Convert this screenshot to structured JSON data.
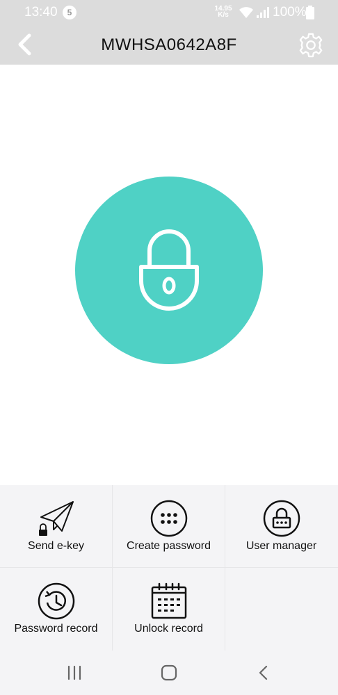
{
  "status_bar": {
    "time": "13:40",
    "notification_count": "5",
    "net_speed_value": "14.95",
    "net_speed_unit": "K/s",
    "battery": "100%"
  },
  "header": {
    "title": "MWHSA0642A8F"
  },
  "lock": {
    "state_icon": "lock-icon",
    "color": "#4fd1c5"
  },
  "menu": {
    "items": [
      {
        "label": "Send e-key",
        "icon": "paper-plane-icon"
      },
      {
        "label": "Create password",
        "icon": "keypad-icon"
      },
      {
        "label": "User manager",
        "icon": "user-lock-icon"
      },
      {
        "label": "Password record",
        "icon": "history-icon"
      },
      {
        "label": "Unlock record",
        "icon": "calendar-icon"
      }
    ]
  },
  "nav": {
    "icons": [
      "recent-apps-icon",
      "home-icon",
      "back-icon"
    ]
  }
}
